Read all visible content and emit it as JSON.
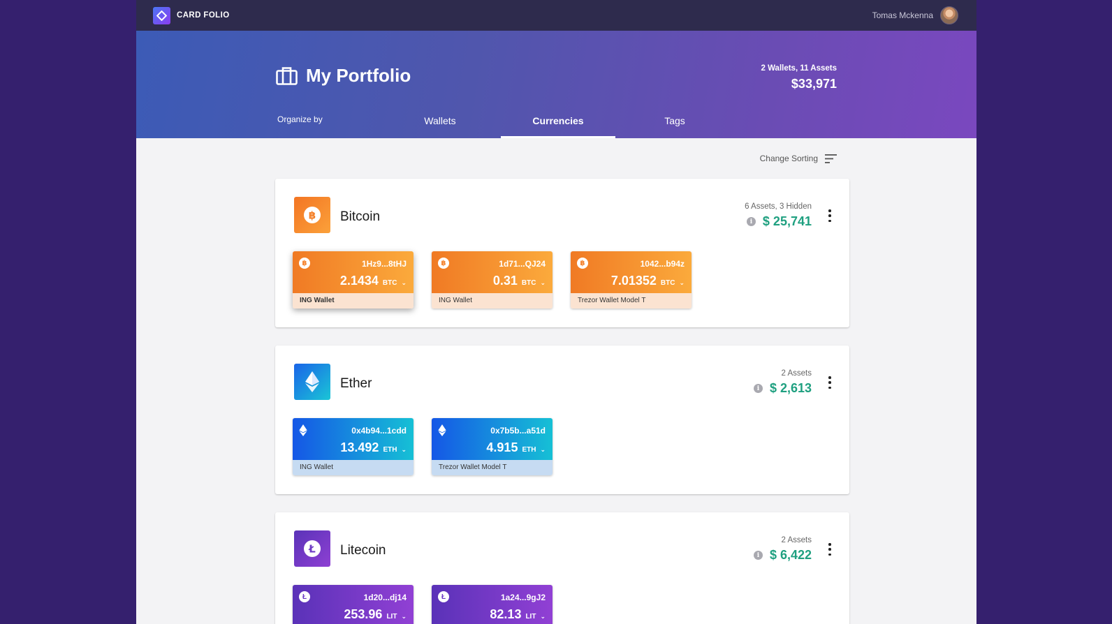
{
  "app": {
    "brand": "CARD FOLIO",
    "user_name": "Tomas Mckenna"
  },
  "header": {
    "title": "My Portfolio",
    "summary_counts": "2 Wallets, 11 Assets",
    "summary_total": "$33,971",
    "organize_label": "Organize by",
    "tabs": [
      {
        "label": "Wallets",
        "active": false
      },
      {
        "label": "Currencies",
        "active": true
      },
      {
        "label": "Tags",
        "active": false
      }
    ]
  },
  "sorting": {
    "label": "Change Sorting"
  },
  "colors": {
    "accent_green": "#1fa080",
    "bitcoin": "#f7931a",
    "ether": "#1a7fe6",
    "litecoin": "#7c3fc9"
  },
  "currencies": [
    {
      "name": "Bitcoin",
      "icon": "bitcoin-icon",
      "assets": "6 Assets, 3 Hidden",
      "amount": "$ 25,741",
      "cards": [
        {
          "address": "1Hz9...8tHJ",
          "value": "2.1434",
          "unit": "BTC",
          "wallet": "ING Wallet"
        },
        {
          "address": "1d71...QJ24",
          "value": "0.31",
          "unit": "BTC",
          "wallet": "ING Wallet"
        },
        {
          "address": "1042...b94z",
          "value": "7.01352",
          "unit": "BTC",
          "wallet": "Trezor Wallet Model T"
        }
      ]
    },
    {
      "name": "Ether",
      "icon": "ethereum-icon",
      "assets": "2 Assets",
      "amount": "$ 2,613",
      "cards": [
        {
          "address": "0x4b94...1cdd",
          "value": "13.492",
          "unit": "ETH",
          "wallet": "ING Wallet"
        },
        {
          "address": "0x7b5b...a51d",
          "value": "4.915",
          "unit": "ETH",
          "wallet": "Trezor Wallet Model T"
        }
      ]
    },
    {
      "name": "Litecoin",
      "icon": "litecoin-icon",
      "assets": "2 Assets",
      "amount": "$ 6,422",
      "cards": [
        {
          "address": "1d20...dj14",
          "value": "253.96",
          "unit": "LIT",
          "wallet": ""
        },
        {
          "address": "1a24...9gJ2",
          "value": "82.13",
          "unit": "LIT",
          "wallet": ""
        }
      ]
    }
  ]
}
